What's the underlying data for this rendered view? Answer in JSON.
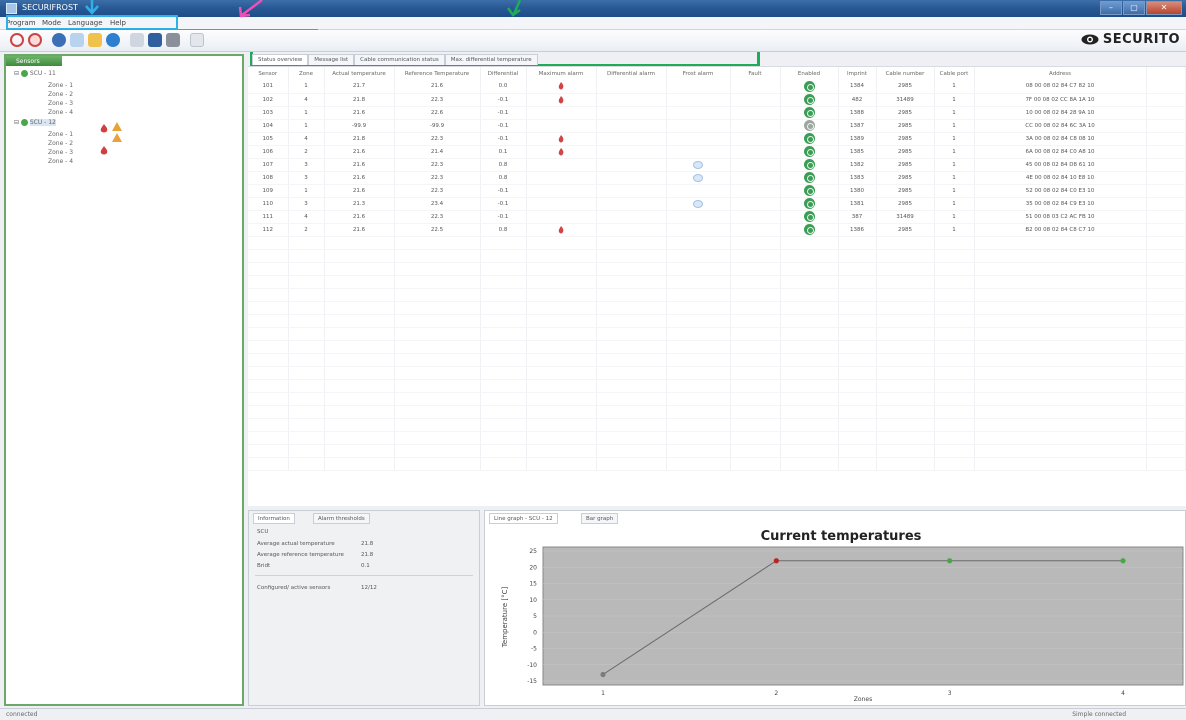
{
  "window": {
    "title": "SECURIFROST"
  },
  "menu": [
    "Program",
    "Mode",
    "Language",
    "Help"
  ],
  "brand": {
    "logo_text": "SECURITO"
  },
  "tree": {
    "header": "Sensors",
    "nodes": [
      {
        "label": "SCU - 11",
        "level": 0,
        "expanded": true
      },
      {
        "label": "Zone - 1",
        "level": 1
      },
      {
        "label": "Zone - 2",
        "level": 1
      },
      {
        "label": "Zone - 3",
        "level": 1
      },
      {
        "label": "Zone - 4",
        "level": 1
      },
      {
        "label": "SCU - 12",
        "level": 0,
        "expanded": true
      },
      {
        "label": "Zone - 1",
        "level": 1
      },
      {
        "label": "Zone - 2",
        "level": 1
      },
      {
        "label": "Zone - 3",
        "level": 1
      },
      {
        "label": "Zone - 4",
        "level": 1
      }
    ]
  },
  "tabs": [
    "Status overview",
    "Message list",
    "Cable communication status",
    "Max. differential temperature"
  ],
  "table": {
    "columns": [
      "Sensor",
      "Zone",
      "Actual temperature",
      "Reference Temperature",
      "Differential",
      "Maximum alarm",
      "Differential alarm",
      "Frost alarm",
      "Fault",
      "Enabled",
      "Imprint",
      "Cable number",
      "Cable port",
      "Address"
    ],
    "rows": [
      [
        "101",
        "1",
        "21.7",
        "21.6",
        "0.0",
        "flame",
        "",
        "",
        "",
        "on",
        "1384",
        "2985",
        "1",
        "08 00 08 02 84 C7 82 10"
      ],
      [
        "102",
        "4",
        "21.8",
        "22.3",
        "-0.1",
        "flame",
        "",
        "",
        "",
        "on",
        "482",
        "31489",
        "1",
        "7F 00 08 02 CC 8A 1A 10"
      ],
      [
        "103",
        "1",
        "21.6",
        "22.6",
        "-0.1",
        "",
        "",
        "",
        "",
        "on",
        "1388",
        "2985",
        "1",
        "10 00 08 02 84 28 9A 10"
      ],
      [
        "104",
        "1",
        "-99.9",
        "-99.9",
        "-0.1",
        "",
        "",
        "",
        "",
        "grey",
        "1387",
        "2985",
        "1",
        "CC 00 08 02 84 6C 3A 10"
      ],
      [
        "105",
        "4",
        "21.8",
        "22.3",
        "-0.1",
        "flame",
        "",
        "",
        "",
        "on",
        "1389",
        "2985",
        "1",
        "3A 00 08 02 84 C8 08 10"
      ],
      [
        "106",
        "2",
        "21.6",
        "21.4",
        "0.1",
        "flame",
        "",
        "",
        "",
        "on",
        "1385",
        "2985",
        "1",
        "6A 00 08 02 84 C0 A8 10"
      ],
      [
        "107",
        "3",
        "21.6",
        "22.3",
        "0.8",
        "",
        "",
        "frost",
        "",
        "on",
        "1382",
        "2985",
        "1",
        "45 00 08 02 84 D8 61 10"
      ],
      [
        "108",
        "3",
        "21.6",
        "22.3",
        "0.8",
        "",
        "",
        "frost",
        "",
        "on",
        "1383",
        "2985",
        "1",
        "4E 00 08 02 84 10 E8 10"
      ],
      [
        "109",
        "1",
        "21.6",
        "22.3",
        "-0.1",
        "",
        "",
        "",
        "",
        "on",
        "1380",
        "2985",
        "1",
        "52 00 08 02 84 C0 E3 10"
      ],
      [
        "110",
        "3",
        "21.3",
        "23.4",
        "-0.1",
        "",
        "",
        "frost",
        "",
        "on",
        "1381",
        "2985",
        "1",
        "35 00 08 02 84 C9 E3 10"
      ],
      [
        "111",
        "4",
        "21.6",
        "22.3",
        "-0.1",
        "",
        "",
        "",
        "",
        "on",
        "387",
        "31489",
        "1",
        "51 00 08 03 C2 AC FB 10"
      ],
      [
        "112",
        "2",
        "21.6",
        "22.5",
        "0.8",
        "flame",
        "",
        "",
        "",
        "on",
        "1386",
        "2985",
        "1",
        "B2 00 08 02 84 C8 C7 10"
      ]
    ]
  },
  "info": {
    "tabs": [
      "Information",
      "Alarm thresholds"
    ],
    "unit": "SCU",
    "rows": [
      {
        "label": "Average actual temperature",
        "value": "21.8"
      },
      {
        "label": "Average reference temperature",
        "value": "21.8"
      },
      {
        "label": "Bridt",
        "value": "0.1"
      }
    ],
    "configured_label": "Configured/ active sensors",
    "configured_value": "12/12"
  },
  "graph": {
    "tabs": [
      "Line graph - SCU - 12",
      "Bar graph"
    ],
    "title": "Current temperatures",
    "ylabel": "Temperature [°C]",
    "xlabel": "Zones",
    "categories": [
      "1",
      "2",
      "3",
      "4"
    ]
  },
  "chart_data": {
    "type": "line",
    "title": "Current temperatures",
    "ylabel": "Temperature [°C]",
    "xlabel": "Zones",
    "categories": [
      "1",
      "2",
      "3",
      "4"
    ],
    "values": [
      -13,
      22,
      22,
      22
    ],
    "point_colors": [
      "#7b7b7b",
      "#c02222",
      "#48a848",
      "#48a848"
    ],
    "ylim": [
      -15,
      25
    ],
    "yticks": [
      25,
      20,
      15,
      10,
      5,
      0,
      -5,
      -10,
      -15
    ],
    "colors": {
      "plot_bg": "#b9b9b9",
      "line": "#6a6a6a"
    }
  },
  "status": {
    "left": "connected",
    "right": "Simple connected"
  }
}
